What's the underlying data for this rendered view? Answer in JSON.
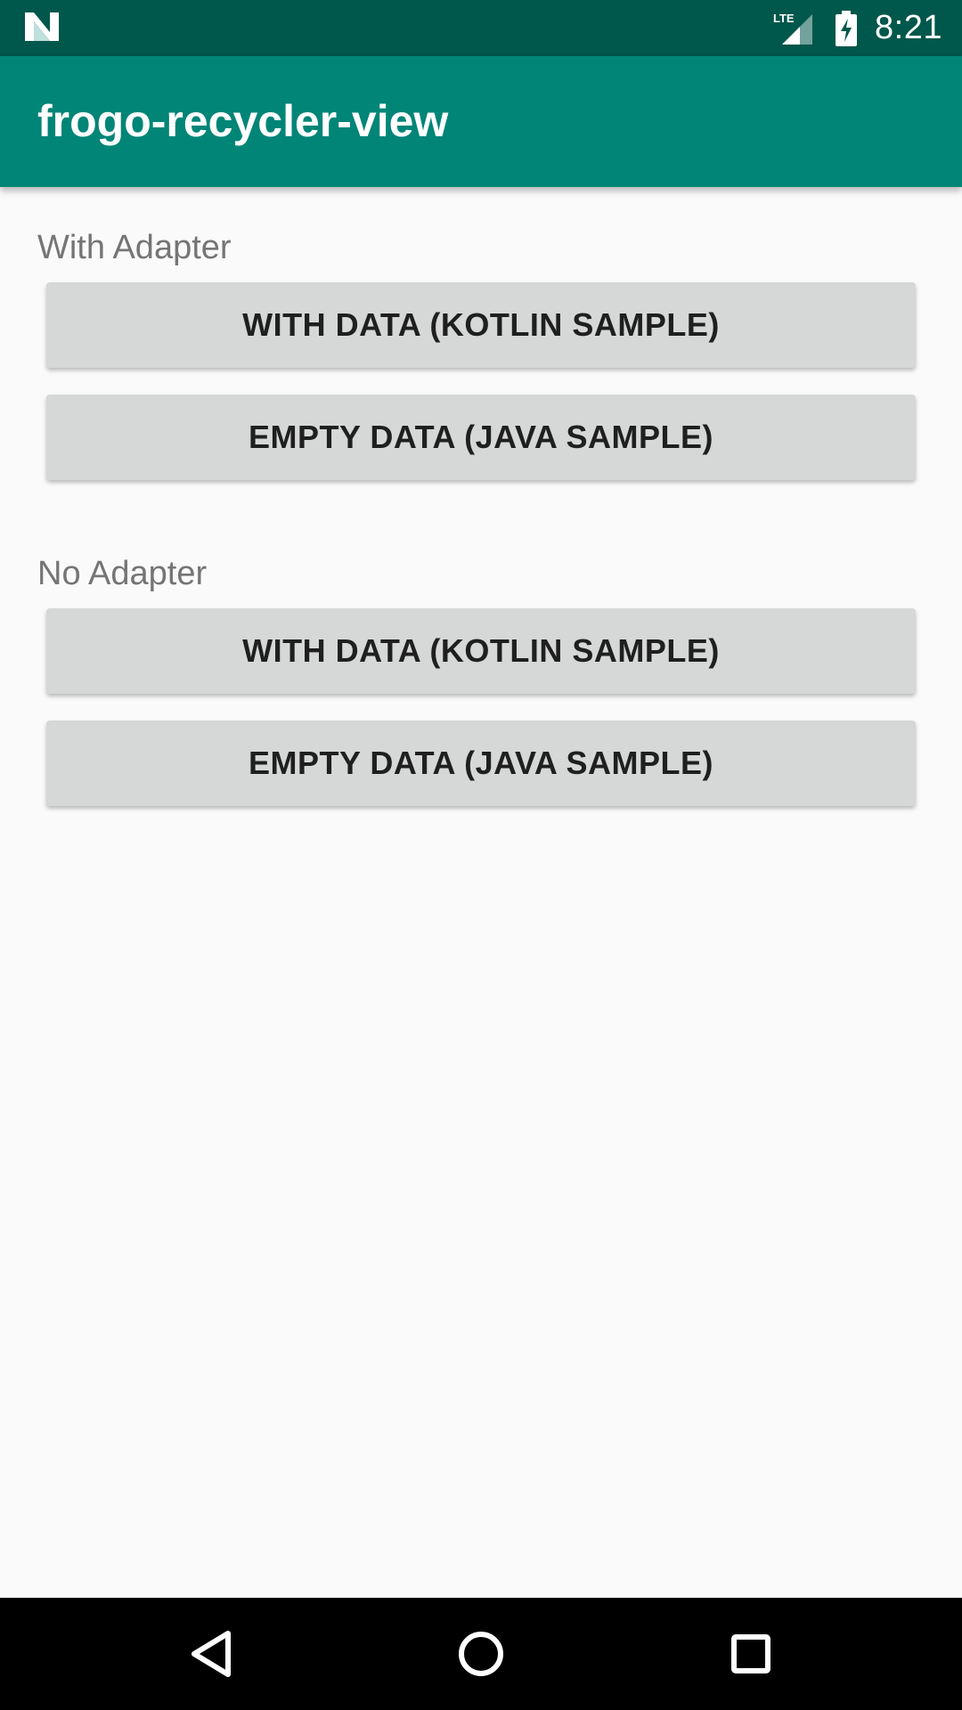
{
  "status_bar": {
    "time": "8:21",
    "network_label": "LTE",
    "left_icon": "notification-n-icon",
    "signal_icon": "cell-signal-icon",
    "battery_icon": "battery-charging-icon"
  },
  "app_bar": {
    "title": "frogo-recycler-view"
  },
  "sections": [
    {
      "label": "With Adapter",
      "buttons": [
        {
          "label": "WITH DATA (KOTLIN SAMPLE)"
        },
        {
          "label": "EMPTY DATA (JAVA SAMPLE)"
        }
      ]
    },
    {
      "label": "No Adapter",
      "buttons": [
        {
          "label": "WITH DATA (KOTLIN SAMPLE)"
        },
        {
          "label": "EMPTY DATA (JAVA SAMPLE)"
        }
      ]
    }
  ],
  "nav_bar": {
    "back_icon": "back-triangle-icon",
    "home_icon": "home-circle-icon",
    "recents_icon": "recents-square-icon"
  },
  "colors": {
    "status_bar": "#00574b",
    "app_bar": "#008577",
    "button_bg": "#d6d7d7",
    "background": "#fafafa"
  }
}
